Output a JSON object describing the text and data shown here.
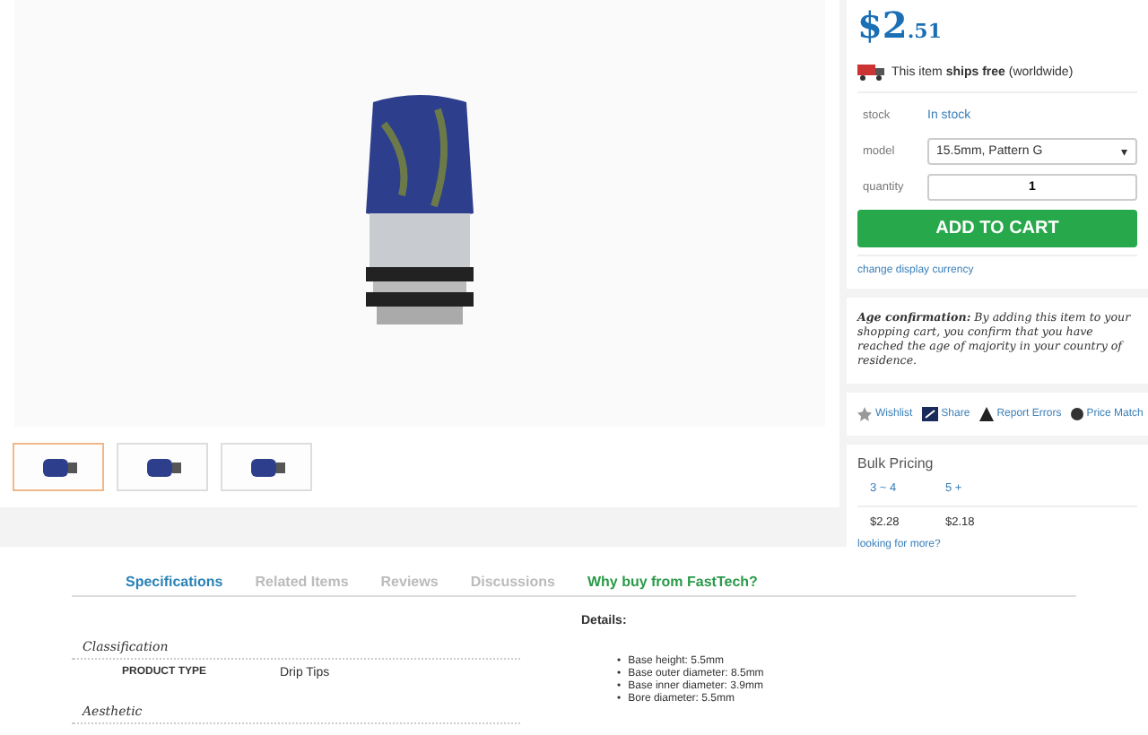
{
  "gallery": {
    "thumbnails": [
      {
        "selected": true
      },
      {
        "selected": false
      },
      {
        "selected": false
      }
    ]
  },
  "price": {
    "main": "$2",
    "cents": ".51"
  },
  "shipping": {
    "text": "This item **ships free** (worldwide)"
  },
  "options": [
    {
      "kind": "text",
      "label": "stock",
      "value": "In stock"
    },
    {
      "kind": "select",
      "label": "model",
      "value": "15.5mm, Pattern G",
      "caret": "▾"
    },
    {
      "kind": "number",
      "label": "quantity",
      "value": "1"
    }
  ],
  "add_to_cart": "ADD TO CART",
  "change_currency": "change display currency",
  "age_notice": "**Age confirmation:** By adding this item to your shopping cart, you confirm that you have reached the age of majority in your country of residence.",
  "actions": [
    {
      "kind": "star",
      "label": "Wishlist"
    },
    {
      "kind": "share",
      "label": "Share"
    },
    {
      "kind": "warn",
      "label": "Report Errors"
    },
    {
      "kind": "money",
      "label": "Price Match"
    }
  ],
  "bulk_pricing": {
    "title": "Bulk Pricing",
    "columns": [
      "3 ~ 4",
      "5 +"
    ],
    "prices": [
      "$2.28",
      "$2.18"
    ],
    "more": "looking for more?"
  },
  "tabs": [
    {
      "label": "Specifications",
      "selected": true,
      "kind": "tab"
    },
    {
      "label": "Related Items",
      "selected": false,
      "kind": "tab"
    },
    {
      "label": "Reviews",
      "selected": false,
      "kind": "tab"
    },
    {
      "label": "Discussions",
      "selected": false,
      "kind": "tab"
    },
    {
      "label": "Why buy from FastTech?",
      "selected": false,
      "kind": "promo"
    }
  ],
  "specs": {
    "sections": [
      {
        "title": "Classification",
        "rows": [
          {
            "name": "PRODUCT TYPE",
            "value": "Drip Tips"
          }
        ]
      },
      {
        "title": "Aesthetic"
      }
    ],
    "details_title": "Details:",
    "details": [
      {
        "marker": "•",
        "text": "Base height: 5.5mm"
      },
      {
        "marker": "•",
        "text": "Base outer diameter: 8.5mm"
      },
      {
        "marker": "•",
        "text": "Base inner diameter: 3.9mm"
      },
      {
        "marker": "•",
        "text": "Bore diameter: 5.5mm"
      }
    ]
  }
}
